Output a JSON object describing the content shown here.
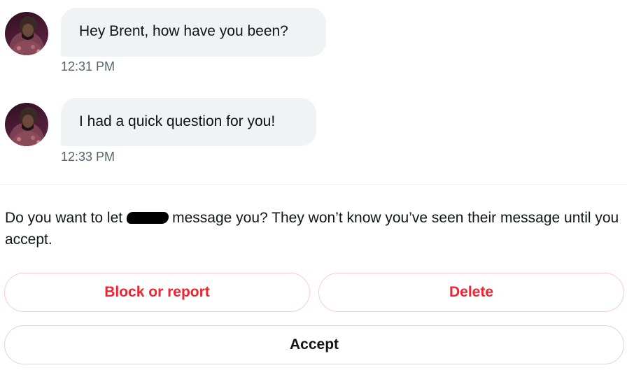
{
  "messages": [
    {
      "text": "Hey Brent, how have you been?",
      "time": "12:31 PM"
    },
    {
      "text": "I had a quick question for you!",
      "time": "12:33 PM"
    }
  ],
  "request": {
    "prompt_before": "Do you want to let",
    "prompt_after": "message you? They won’t know you’ve seen their message until you accept."
  },
  "buttons": {
    "block_or_report": "Block or report",
    "delete": "Delete",
    "accept": "Accept"
  },
  "colors": {
    "danger": "#f4212e",
    "bubble": "#eff3f4",
    "timestamp": "#536471"
  },
  "icons": {
    "avatar": "avatar-photo"
  }
}
